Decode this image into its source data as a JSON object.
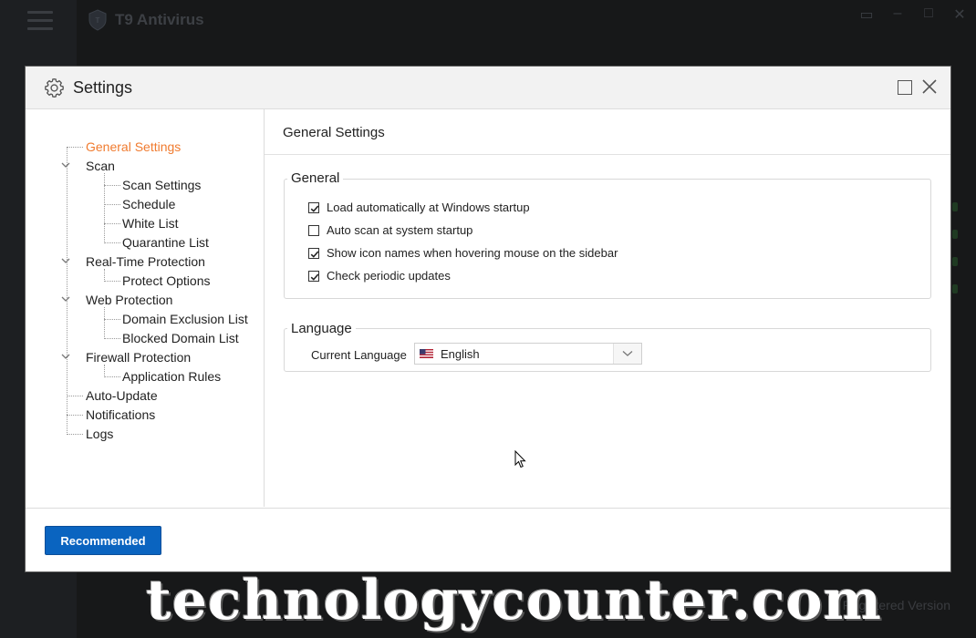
{
  "background_app": {
    "title": "T9 Antivirus",
    "registration_text": "Registered Version"
  },
  "dialog": {
    "title": "Settings",
    "icons": {
      "title": "gear-icon",
      "maximize": "maximize-icon",
      "close": "close-icon"
    }
  },
  "tree": {
    "items": [
      {
        "label": "General Settings",
        "active": true
      },
      {
        "label": "Scan",
        "expanded": true
      },
      {
        "label": "Scan Settings"
      },
      {
        "label": "Schedule"
      },
      {
        "label": "White List"
      },
      {
        "label": "Quarantine List"
      },
      {
        "label": "Real-Time Protection",
        "expanded": true
      },
      {
        "label": "Protect Options"
      },
      {
        "label": "Web Protection",
        "expanded": true
      },
      {
        "label": "Domain Exclusion List"
      },
      {
        "label": "Blocked Domain List"
      },
      {
        "label": "Firewall Protection",
        "expanded": true
      },
      {
        "label": "Application Rules"
      },
      {
        "label": "Auto-Update"
      },
      {
        "label": "Notifications"
      },
      {
        "label": "Logs"
      }
    ]
  },
  "content": {
    "section_title": "General Settings",
    "general_group": {
      "legend": "General",
      "options": [
        {
          "label": "Load automatically at Windows startup",
          "checked": true
        },
        {
          "label": "Auto scan at system startup",
          "checked": false
        },
        {
          "label": "Show icon names when hovering mouse on the sidebar",
          "checked": true
        },
        {
          "label": "Check periodic updates",
          "checked": true
        }
      ]
    },
    "language_group": {
      "legend": "Language",
      "current_language_label": "Current Language",
      "selected_language": "English",
      "flag_icon": "us-flag-icon"
    }
  },
  "footer": {
    "recommended_button": "Recommended"
  },
  "watermark": "technologycounter.com",
  "colors": {
    "accent_active": "#f07b2f",
    "primary_button": "#0a64c0"
  }
}
